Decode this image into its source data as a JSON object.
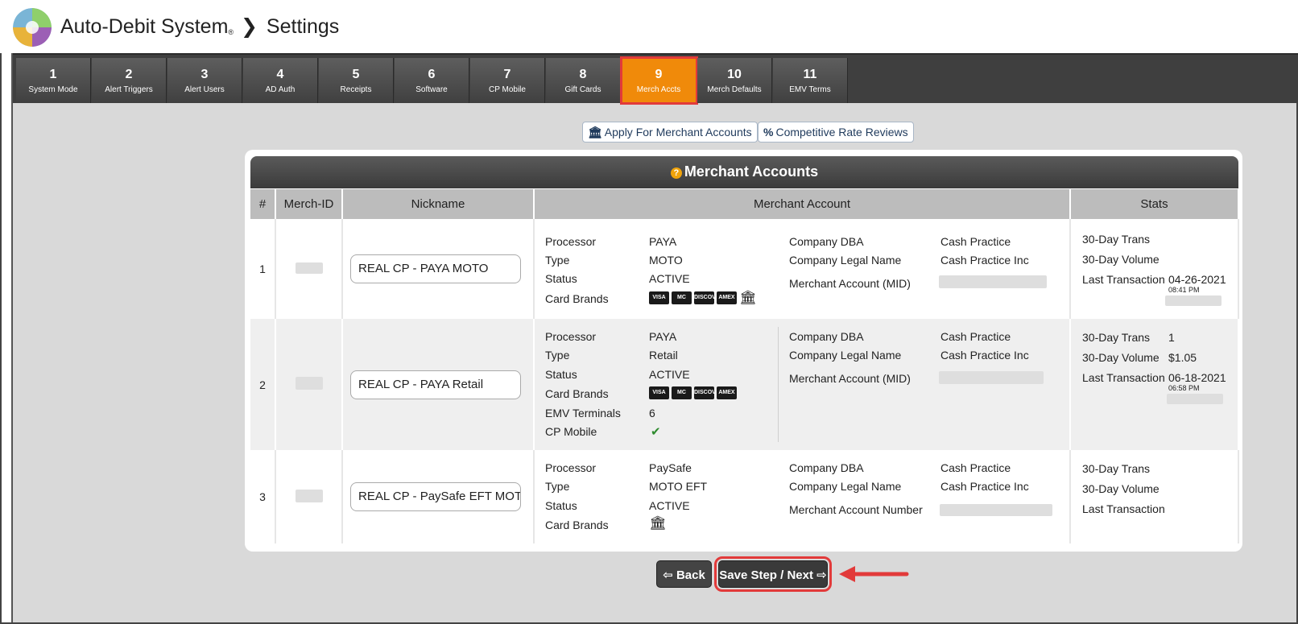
{
  "header": {
    "app_title": "Auto-Debit System",
    "registered_mark": "®",
    "page": "Settings"
  },
  "tabs": [
    {
      "num": "1",
      "label": "System Mode"
    },
    {
      "num": "2",
      "label": "Alert Triggers"
    },
    {
      "num": "3",
      "label": "Alert Users"
    },
    {
      "num": "4",
      "label": "AD Auth"
    },
    {
      "num": "5",
      "label": "Receipts"
    },
    {
      "num": "6",
      "label": "Software"
    },
    {
      "num": "7",
      "label": "CP Mobile"
    },
    {
      "num": "8",
      "label": "Gift Cards"
    },
    {
      "num": "9",
      "label": "Merch Accts",
      "active": true
    },
    {
      "num": "10",
      "label": "Merch Defaults"
    },
    {
      "num": "11",
      "label": "EMV Terms"
    }
  ],
  "actions": {
    "apply_label": "Apply For Merchant Accounts",
    "rates_label": "Competitive Rate Reviews"
  },
  "panel": {
    "title": "Merchant Accounts",
    "columns": {
      "num": "#",
      "merch_id": "Merch-ID",
      "nickname": "Nickname",
      "account": "Merchant Account",
      "stats": "Stats"
    }
  },
  "labels": {
    "processor": "Processor",
    "type": "Type",
    "status": "Status",
    "card_brands": "Card Brands",
    "emv_terminals": "EMV Terminals",
    "cp_mobile": "CP Mobile",
    "company_dba": "Company DBA",
    "company_legal": "Company Legal Name",
    "mid": "Merchant Account (MID)",
    "acct_number": "Merchant Account Number",
    "trans_30": "30-Day Trans",
    "volume_30": "30-Day Volume",
    "last_trans": "Last Transaction"
  },
  "card_icons": {
    "visa": "VISA",
    "mastercard": "MC",
    "discover": "DISCOVER",
    "amex": "AMEX"
  },
  "rows": [
    {
      "num": "1",
      "nickname": "REAL CP - PAYA MOTO",
      "processor": "PAYA",
      "type": "MOTO",
      "status": "ACTIVE",
      "company_dba": "Cash Practice",
      "company_legal": "Cash Practice Inc",
      "trans_30": "",
      "volume_30": "",
      "last_date": "04-26-2021",
      "last_time": "08:41 PM"
    },
    {
      "num": "2",
      "nickname": "REAL CP - PAYA Retail",
      "processor": "PAYA",
      "type": "Retail",
      "status": "ACTIVE",
      "emv_terminals": "6",
      "company_dba": "Cash Practice",
      "company_legal": "Cash Practice Inc",
      "trans_30": "1",
      "volume_30": "$1.05",
      "last_date": "06-18-2021",
      "last_time": "06:58 PM"
    },
    {
      "num": "3",
      "nickname": "REAL CP - PaySafe EFT MOT",
      "processor": "PaySafe",
      "type": "MOTO EFT",
      "status": "ACTIVE",
      "company_dba": "Cash Practice",
      "company_legal": "Cash Practice Inc",
      "trans_30": "",
      "volume_30": "",
      "last_date": "",
      "last_time": ""
    }
  ],
  "buttons": {
    "back_label": "Back",
    "next_label": "Save Step / Next"
  },
  "colors": {
    "accent_tab": "#f08a0a",
    "highlight": "#e23a3a",
    "check": "#2e8b2e"
  }
}
